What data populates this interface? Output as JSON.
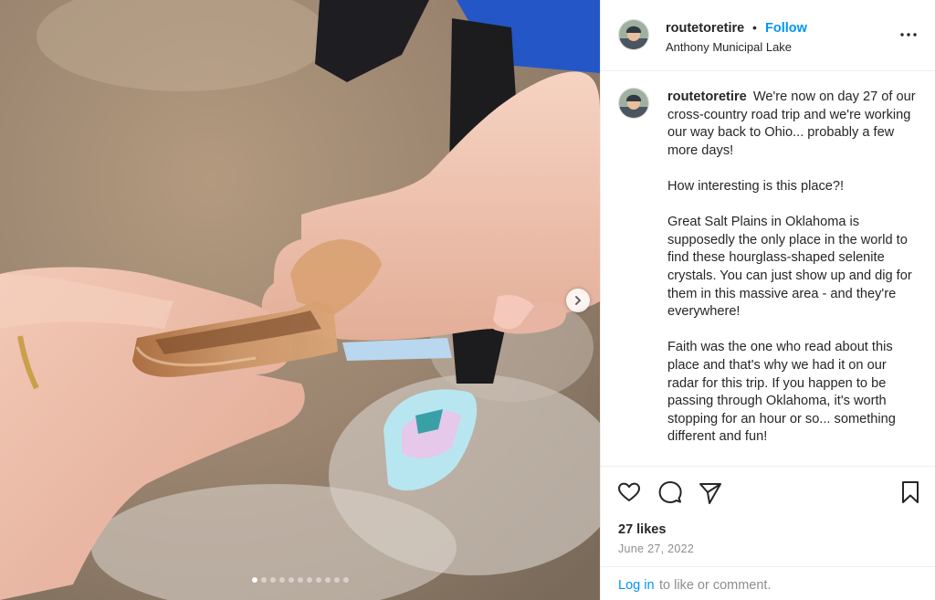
{
  "post": {
    "username": "routetoretire",
    "separator": "•",
    "follow_label": "Follow",
    "location": "Anthony Municipal Lake",
    "caption": {
      "username": "routetoretire",
      "paragraphs": [
        "We're now on day 27 of our cross-country road trip and we're working our way back to Ohio... probably a few more days!",
        "How interesting is this place?!",
        "Great Salt Plains in Oklahoma is supposedly the only place in the world to find these hourglass-shaped selenite crystals. You can just show up and dig for them in this massive area - and they're everywhere!",
        "Faith was the one who read about this place and that's why we had it on our radar for this trip. If you happen to be passing through Oklahoma, it's worth stopping for an hour or so... something different and fun!"
      ]
    },
    "likes": "27 likes",
    "date": "June 27, 2022",
    "login": {
      "link": "Log in",
      "rest": "to like or comment."
    }
  },
  "carousel": {
    "total": 11,
    "active": 1
  },
  "icons": {
    "more": "more-options-icon",
    "like": "heart-icon",
    "comment": "comment-icon",
    "share": "paper-plane-icon",
    "save": "bookmark-icon",
    "next": "chevron-right-icon"
  },
  "colors": {
    "link_blue": "#0095f6",
    "text": "#262626",
    "muted": "#8e8e8e",
    "divider": "#efefef"
  }
}
